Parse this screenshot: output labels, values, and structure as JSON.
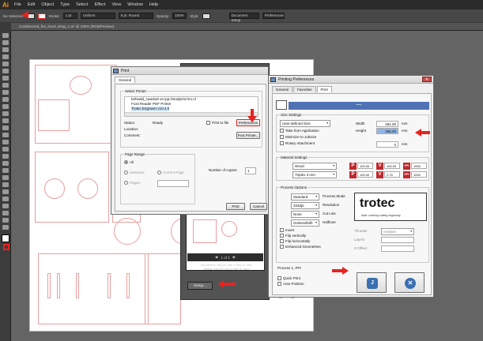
{
  "app": {
    "logo": "Ai",
    "menu": [
      "File",
      "Edit",
      "Object",
      "Type",
      "Select",
      "Effect",
      "View",
      "Window",
      "Help"
    ],
    "options_bar": {
      "no_selection": "No Selection",
      "stroke_label": "Stroke:",
      "stroke_value": "1 pt",
      "uniform": "Uniform",
      "brush": "5 pt. Round",
      "opacity_label": "Opacity:",
      "opacity_value": "100%",
      "style_label": "Style:",
      "doc_setup": "Document Setup",
      "preferences": "Preferences"
    },
    "doc_tab": "Cantilevered_fire_hood_strap_1.ai* @ 100% (RGB/Preview)"
  },
  "preview_dialog": {
    "page_indicator": "1 of 2",
    "document_info": "Document: 280,21 mm x 264,21 mm",
    "media_info": "Media: 100,00 mm x 200,07 mm",
    "setup_button": "Setup..."
  },
  "print_dialog": {
    "title": "Print",
    "tab": "General",
    "select_printer_label": "Select Printer",
    "printers": [
      "beheald_zwartwit on ipp://studprint.hro.nl",
      "Foxit Reader PDF Printer",
      "Trotec Engraver v10.4.0"
    ],
    "status_label": "Status:",
    "status_value": "Ready",
    "location_label": "Location:",
    "comment_label": "Comment:",
    "print_to_file": "Print to file",
    "preferences_button": "Preferences",
    "find_printer_button": "Find Printer...",
    "page_range_label": "Page Range",
    "range_all": "All",
    "range_selection": "Selection",
    "range_current": "Current Page",
    "range_pages": "Pages:",
    "copies_label": "Number of copies:",
    "copies_value": "1",
    "print_button": "Print",
    "cancel_button": "Cancel"
  },
  "prefs_dialog": {
    "title": "Printing Preferences",
    "tabs": [
      "General",
      "Favorites",
      "Print"
    ],
    "size_settings_label": "Size Settings",
    "size_select": "User-defined Size",
    "width_label": "Width",
    "width_value": "281.00",
    "height_label": "Height",
    "height_value": "265.00",
    "unit": "mm",
    "take_from_app": "Take from Application",
    "minimize_jobsize": "Minimize to Jobsize",
    "rotary_attachment": "Rotary Attachment",
    "rotary_value": "0",
    "material_settings_label": "Material Settings",
    "material_select": "Wood",
    "material_sub": "Triplex 3 mm",
    "p_label": "P",
    "v_label": "V",
    "ppi_label": "PPI",
    "p_value": "100.00",
    "v_value": "100.00",
    "ppi_value": "1000",
    "p_value2": "100.00",
    "v_value2": "2.75",
    "ppi_value2": "1000",
    "process_options_label": "Process Options",
    "process_mode": "Standard",
    "process_mode_label": "Process Mode",
    "resolution": "333dpi",
    "resolution_label": "Resolution",
    "cut_line": "None",
    "cut_line_label": "Cut Line",
    "halftone": "OrderedDith",
    "halftone_label": "Halftone",
    "invert": "Invert",
    "flip_vertical": "Flip vertically",
    "flip_horizontal": "Flip horizontally",
    "enhanced_geometries": "Enhanced Geometries",
    "brand_name": "trotec",
    "brand_tagline": "laser. marking cutting engraving",
    "thruster_label": "Thruster",
    "thruster_value": "medium",
    "layers_label": "Layers",
    "z_offset_label": "Z-Offset",
    "process_count": "Process 1, PPI",
    "quick_print": "Quick Print",
    "auto_position": "Auto Position"
  },
  "colors": {
    "annotation_arrow": "#e8231f",
    "header_blue": "#4f72b5",
    "p_color": "#c0282d",
    "v_color": "#c0282d",
    "ppi_color": "#c0282d"
  }
}
